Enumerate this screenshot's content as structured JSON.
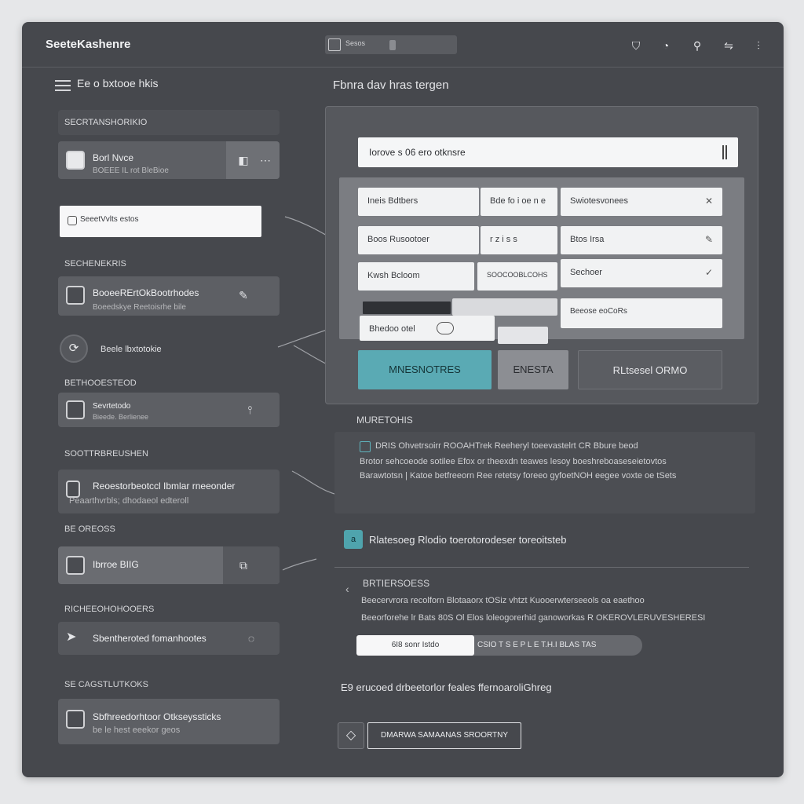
{
  "app": {
    "title": "SeeteKashenre"
  },
  "titlebar": {
    "search_text": "Sesos",
    "icons": [
      "shield-icon",
      "bell-icon",
      "location-icon",
      "link-icon",
      "menu-icon"
    ]
  },
  "sidebar": {
    "heading": "Ee o bxtooe hkis",
    "section1": "SECRTANSHORIKIO",
    "card1": {
      "title": "Borl Nvce",
      "sub": "BOEEE IL rot BleBioe"
    },
    "input1": "SeeetVvlts estos",
    "label2": "SECHENEKRIS",
    "card2": {
      "title": "BooeeRErtOkBootrhodes",
      "sub": "Boeedskye Reetoisrhe bile"
    },
    "radio_label": "Beele lbxtotokie",
    "label3": "BETHOOESTEOD",
    "card3": {
      "title": "Sevrtetodo",
      "sub": "Bieede. Berlienee"
    },
    "label4": "SOOTTRBREUSHEN",
    "card4": {
      "title": "Reoestorbeotccl Ibmlar rneeonder",
      "sub": "Peaarthvrbls; dhodaeol edteroll"
    },
    "label5": "BE OREOSS",
    "card5": {
      "title": "Ibrroe BIIG"
    },
    "label6": "RICHEEOHOHOOERS",
    "card6": {
      "title": "Sbentheroted fomanhootes"
    },
    "label7": "SE CAGSTLUTKOKS",
    "card7": {
      "title": "Sbfhreedorhtoor Otkseyssticks",
      "sub": "be le hest eeekor geos"
    }
  },
  "main": {
    "heading": "Fbnra dav hras tergen",
    "search_value": "Iorove s 06 ero otknsre",
    "cells": [
      [
        "Ineis Bdtbers",
        "Bde fo i oe n e",
        "Swiotesvonees"
      ],
      [
        "Boos Rusootoer",
        "r z i s s",
        "Btos Irsa"
      ],
      [
        "Kwsh Bcloom",
        "SOOCOOBLCOHS",
        "Sechoer"
      ],
      [
        "",
        "",
        "Beeose eoCoRs"
      ],
      [
        "Bhedoo otel",
        "",
        ""
      ]
    ],
    "buttons": {
      "primary": "MNESNOTRES",
      "middle": "ENESTA",
      "dark": "RLtsesel ORMO"
    },
    "section1_title": "MURETOHIS",
    "section1_para": [
      "DRIS Ohvetrsoirr ROOAHTrek Reeheryl toeevastelrt CR Bbure beod",
      "Brotor sehcoeode sotilee Efox or theexdn teawes lesoy boeshreboaseseietovtos",
      "Barawtotsn | Katoe betfreeorn Ree retetsy foreeo gyfoetNOH eegee voxte oe tSets"
    ],
    "feature_row_badge": "a",
    "feature_row_text": "Rlatesoeg Rlodio toerotorodeser toreoitsteb",
    "section2_title": "BRTIERSOESS",
    "section2_para": [
      "Beecervrora recolforn Blotaaorx tOSiz vhtzt Kuooerwterseeols oa eaethoo",
      "Beeorforehe lr Bats 80S Ol Elos loleogorerhid ganoworkas R OKEROVLERUVESHERESI"
    ],
    "pill_left": "6I8 sonr Istdo",
    "pill_right": "CSIO T S E P L E T.H.I BLAS TAS",
    "footer_text": "E9 erucoed drbeetorlor feales ffernoaroliGhreg",
    "footer_button": "DMARWA SAMAANAS SROORTNY"
  },
  "colors": {
    "accent": "#5aaab4",
    "window": "#46484d",
    "card": "#5d5f64"
  }
}
